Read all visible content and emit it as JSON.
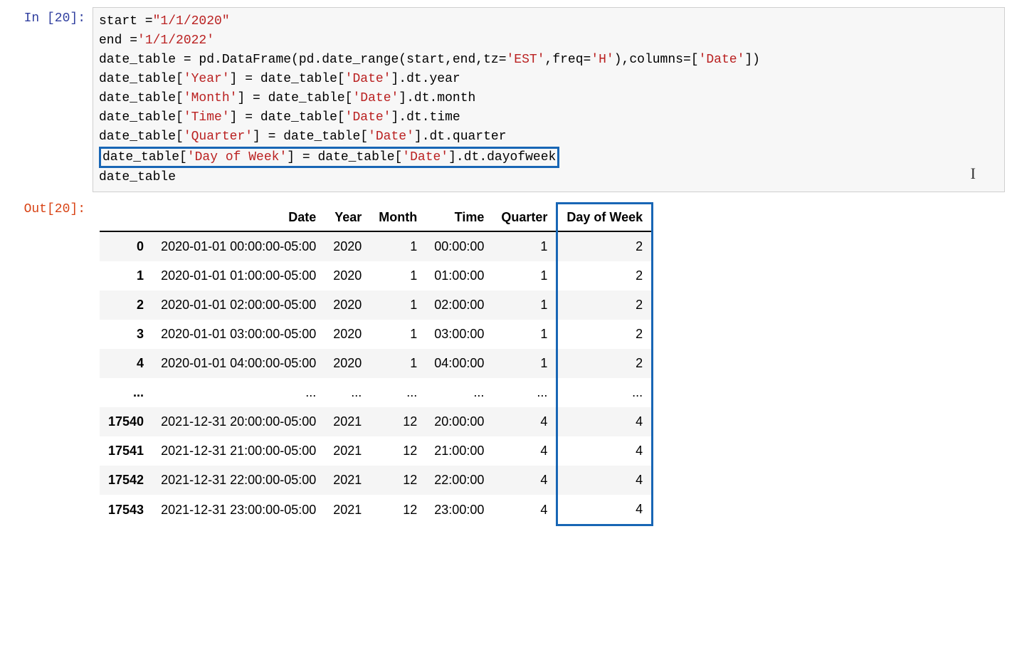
{
  "in_prompt": "In [20]:",
  "out_prompt": "Out[20]:",
  "code": {
    "start_assign": "start =",
    "start_val": "\"1/1/2020\"",
    "end_assign": "end =",
    "end_val": "'1/1/2022'",
    "line3a": "date_table = pd.DataFrame(pd.date_range(start,end,tz=",
    "line3b": "'EST'",
    "line3c": ",freq=",
    "line3d": "'H'",
    "line3e": "),columns=[",
    "line3f": "'Date'",
    "line3g": "])",
    "line4a": "date_table[",
    "line4b": "'Year'",
    "line4c": "] = date_table[",
    "line4d": "'Date'",
    "line4e": "].dt.year",
    "line5a": "date_table[",
    "line5b": "'Month'",
    "line5c": "] = date_table[",
    "line5d": "'Date'",
    "line5e": "].dt.month",
    "line6a": "date_table[",
    "line6b": "'Time'",
    "line6c": "] = date_table[",
    "line6d": "'Date'",
    "line6e": "].dt.time",
    "line7a": "date_table[",
    "line7b": "'Quarter'",
    "line7c": "] = date_table[",
    "line7d": "'Date'",
    "line7e": "].dt.quarter",
    "line8a": "date_table[",
    "line8b": "'Day of Week'",
    "line8c": "] = date_table[",
    "line8d": "'Date'",
    "line8e": "].dt.dayofweek",
    "line9": "date_table"
  },
  "cursor_char": "I",
  "table": {
    "columns": [
      "Date",
      "Year",
      "Month",
      "Time",
      "Quarter",
      "Day of Week"
    ],
    "rows": [
      {
        "index": "0",
        "cells": [
          "2020-01-01 00:00:00-05:00",
          "2020",
          "1",
          "00:00:00",
          "1",
          "2"
        ]
      },
      {
        "index": "1",
        "cells": [
          "2020-01-01 01:00:00-05:00",
          "2020",
          "1",
          "01:00:00",
          "1",
          "2"
        ]
      },
      {
        "index": "2",
        "cells": [
          "2020-01-01 02:00:00-05:00",
          "2020",
          "1",
          "02:00:00",
          "1",
          "2"
        ]
      },
      {
        "index": "3",
        "cells": [
          "2020-01-01 03:00:00-05:00",
          "2020",
          "1",
          "03:00:00",
          "1",
          "2"
        ]
      },
      {
        "index": "4",
        "cells": [
          "2020-01-01 04:00:00-05:00",
          "2020",
          "1",
          "04:00:00",
          "1",
          "2"
        ]
      },
      {
        "index": "...",
        "cells": [
          "...",
          "...",
          "...",
          "...",
          "...",
          "..."
        ]
      },
      {
        "index": "17540",
        "cells": [
          "2021-12-31 20:00:00-05:00",
          "2021",
          "12",
          "20:00:00",
          "4",
          "4"
        ]
      },
      {
        "index": "17541",
        "cells": [
          "2021-12-31 21:00:00-05:00",
          "2021",
          "12",
          "21:00:00",
          "4",
          "4"
        ]
      },
      {
        "index": "17542",
        "cells": [
          "2021-12-31 22:00:00-05:00",
          "2021",
          "12",
          "22:00:00",
          "4",
          "4"
        ]
      },
      {
        "index": "17543",
        "cells": [
          "2021-12-31 23:00:00-05:00",
          "2021",
          "12",
          "23:00:00",
          "4",
          "4"
        ]
      }
    ],
    "highlight_column_index": 5
  }
}
